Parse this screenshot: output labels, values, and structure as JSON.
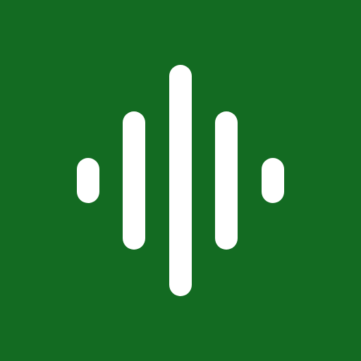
{
  "app_icon": {
    "icon": "audio-waveform-icon",
    "background_color": "#136b22",
    "foreground_color": "#ffffff",
    "bar_levels": [
      0.2,
      0.6,
      1.0,
      0.6,
      0.2
    ]
  }
}
